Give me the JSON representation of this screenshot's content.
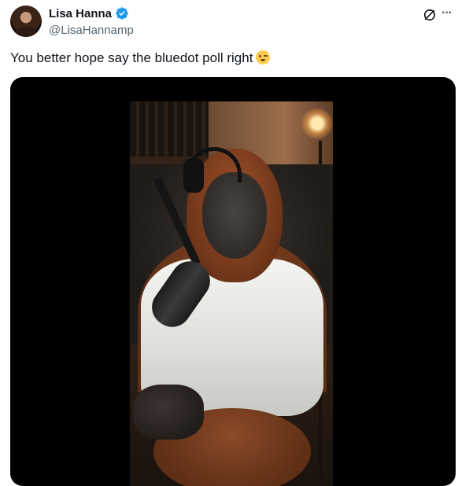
{
  "author": {
    "name": "Lisa Hanna",
    "handle": "@LisaHannamp",
    "verified": true
  },
  "icons": {
    "verified": "verified-badge-icon",
    "grok": "grok-icon",
    "more": "more-options-icon",
    "emoji": "winking-face-with-tongue-emoji"
  },
  "tweet": {
    "text": "You better hope say the bluedot poll right"
  },
  "colors": {
    "verified_blue": "#1d9bf0",
    "text_primary": "#0f1419",
    "text_secondary": "#536471",
    "media_background": "#000000"
  }
}
